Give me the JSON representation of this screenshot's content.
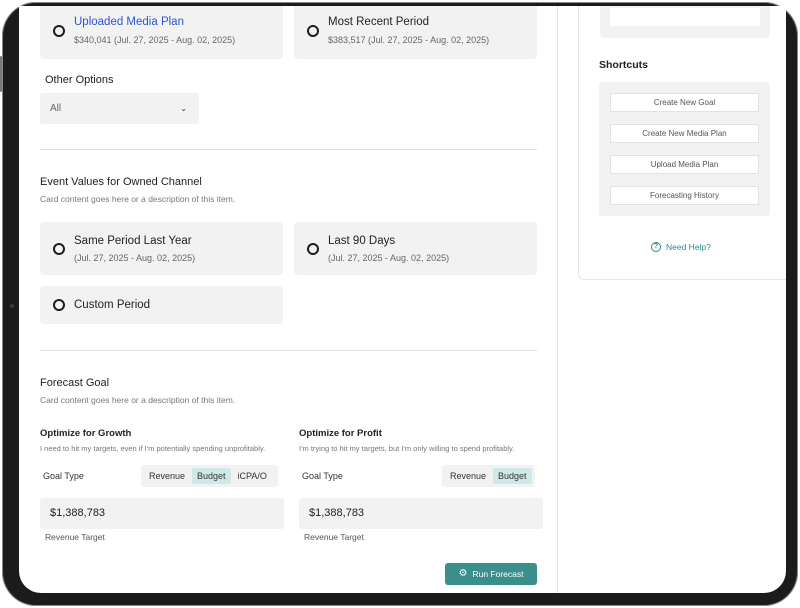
{
  "period_options": [
    {
      "title": "Uploaded Media Plan",
      "subtitle": "$340,041 (Jul. 27, 2025 - Aug. 02, 2025)"
    },
    {
      "title": "Most Recent Period",
      "subtitle": "$383,517 (Jul. 27, 2025 - Aug. 02, 2025)"
    }
  ],
  "other_options": {
    "label": "Other Options",
    "value": "All"
  },
  "owned_channel": {
    "title": "Event Values for Owned Channel",
    "description": "Card content goes here or a description of this item.",
    "options": [
      {
        "title": "Same Period Last Year",
        "subtitle": "(Jul. 27, 2025 - Aug. 02, 2025)"
      },
      {
        "title": "Last 90 Days",
        "subtitle": "(Jul. 27, 2025 - Aug. 02, 2025)"
      },
      {
        "title": "Custom Period"
      }
    ]
  },
  "forecast_goal": {
    "title": "Forecast Goal",
    "description": "Card content goes here or a description of this item.",
    "growth": {
      "title": "Optimize for Growth",
      "description": "I need to hit my targets, even if I'm potentially spending unprofitably.",
      "goal_type_label": "Goal Type",
      "segments": [
        "Revenue",
        "Budget",
        "iCPA/O"
      ],
      "active_segment": "Budget",
      "value": "$1,388,783",
      "value_label": "Revenue Target"
    },
    "profit": {
      "title": "Optimize for Profit",
      "description": "I'm trying to hit my targets, but I'm only willing to spend profitably.",
      "goal_type_label": "Goal Type",
      "segments": [
        "Revenue",
        "Budget"
      ],
      "active_segment": "Budget",
      "value": "$1,388,783",
      "value_label": "Revenue Target"
    },
    "run_button": "Run Forecast"
  },
  "sidebar": {
    "shortcuts_title": "Shortcuts",
    "shortcuts": [
      "Create New Goal",
      "Create New Media Plan",
      "Upload Media Plan",
      "Forecasting History"
    ],
    "help": "Need Help?"
  },
  "icons": {
    "radio": "radio-icon",
    "chevron": "chevron-down-icon",
    "gear": "gear-icon",
    "help": "question-circle-icon"
  },
  "colors": {
    "accent": "#3a8f8d",
    "link": "#2a55d6",
    "card_bg": "#f2f2f2",
    "active_segment": "#cfe8e8"
  }
}
